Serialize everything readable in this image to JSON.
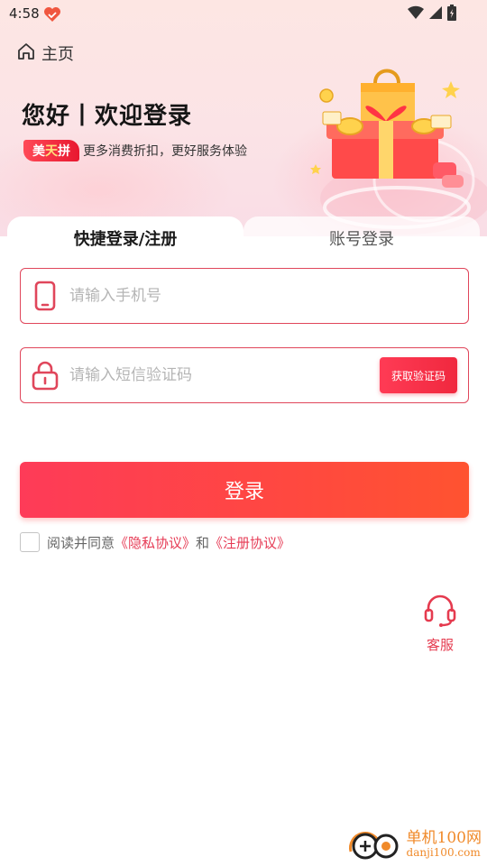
{
  "status_bar": {
    "time": "4:58",
    "app_icon": "heart-app-icon",
    "icons": [
      "wifi-icon",
      "cell-signal-icon",
      "battery-icon"
    ]
  },
  "nav": {
    "home_label": "主页",
    "home_icon": "home-icon"
  },
  "hero": {
    "title": "您好丨欢迎登录",
    "brand": {
      "part1": "美",
      "part2": "天",
      "part3": "拼"
    },
    "tagline": "更多消费折扣，更好服务体验"
  },
  "tabs": [
    {
      "label": "快捷登录/注册",
      "active": true
    },
    {
      "label": "账号登录",
      "active": false
    }
  ],
  "form": {
    "phone": {
      "placeholder": "请输入手机号",
      "value": "",
      "icon": "phone-icon"
    },
    "code": {
      "placeholder": "请输入短信验证码",
      "value": "",
      "icon": "lock-icon"
    },
    "get_code_label": "获取验证码",
    "login_label": "登录"
  },
  "agreement": {
    "checked": false,
    "prefix": "阅读并同意",
    "privacy": "《隐私协议》",
    "and": "和",
    "register": "《注册协议》"
  },
  "customer_service": {
    "label": "客服",
    "icon": "headset-icon"
  },
  "watermark": {
    "cn": "单机100网",
    "en": "danji100.com"
  },
  "colors": {
    "accent": "#ff3b55",
    "accent_text": "#e63b55",
    "hero_bg": "#fde6e3"
  }
}
